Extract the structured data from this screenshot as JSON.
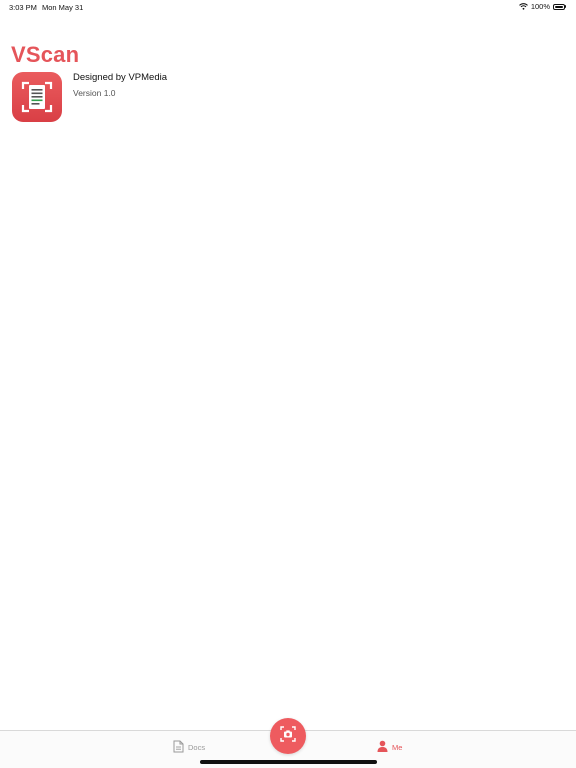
{
  "status_bar": {
    "time": "3:03 PM",
    "date": "Mon May 31",
    "battery": "100%",
    "wifi_icon": "wifi-icon",
    "battery_icon": "battery-icon"
  },
  "header": {
    "title": "VScan"
  },
  "app_info": {
    "icon": "document-scan-icon",
    "designer": "Designed by VPMedia",
    "version": "Version 1.0"
  },
  "tab_bar": {
    "tabs": [
      {
        "label": "Docs",
        "icon": "document-icon",
        "active": false
      },
      {
        "label": "Me",
        "icon": "person-icon",
        "active": true
      }
    ],
    "scan_button_icon": "camera-scan-icon"
  },
  "colors": {
    "accent": "#e5555a",
    "inactive": "#999999"
  }
}
